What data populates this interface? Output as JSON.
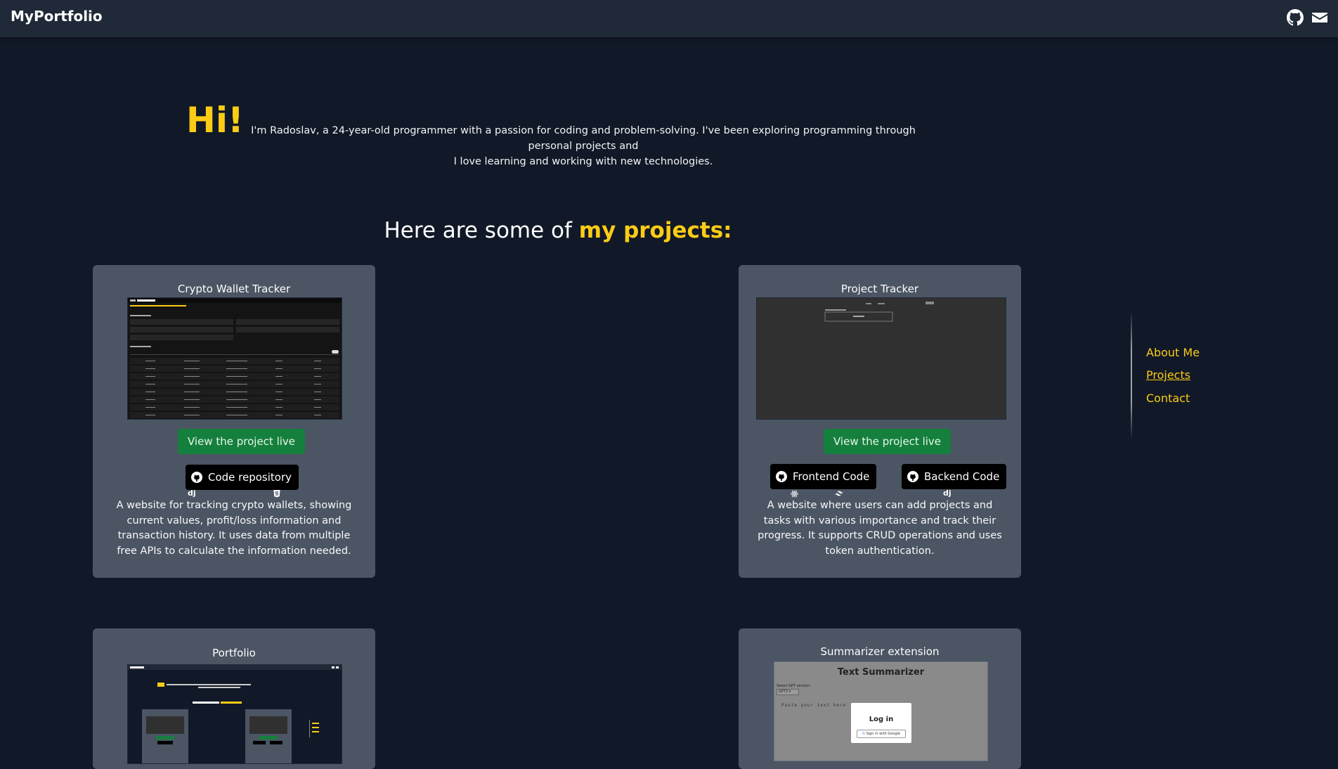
{
  "header": {
    "brand": "MyPortfolio",
    "icons": {
      "github": "github-icon",
      "mail": "mail-icon"
    }
  },
  "hero": {
    "greeting": "Hi!",
    "intro_line1": "I'm Radoslav, a 24-year-old programmer with a passion for coding and problem-solving. I've been exploring programming through personal projects and",
    "intro_line2": "I love learning and working with new technologies."
  },
  "projects_heading": {
    "prefix": "Here are some of ",
    "highlight": "my projects:"
  },
  "projects": [
    {
      "title": "Crypto Wallet Tracker",
      "live_label": "View the project live",
      "code_labels": [
        "Code repository"
      ],
      "tech_icons": [
        "django-icon",
        "html5-icon"
      ],
      "tech_text": [
        "dj"
      ],
      "description": "A website for tracking crypto wallets, showing current values, profit/loss information and transaction history. It uses data from multiple free APIs to calculate the information needed."
    },
    {
      "title": "Project Tracker",
      "live_label": "View the project live",
      "code_labels": [
        "Frontend Code",
        "Backend Code"
      ],
      "tech_icons": [
        "react-icon",
        "tailwind-icon",
        "django-icon"
      ],
      "tech_text": [
        "dj"
      ],
      "description": "A website where users can add projects and tasks with various importance and track their progress. It supports CRUD operations and uses token authentication."
    },
    {
      "title": "Portfolio"
    },
    {
      "title": "Summarizer extension",
      "preview": {
        "heading": "Text Summarizer",
        "select_label": "Select GPT version:",
        "select_value": "GPT3",
        "textarea_placeholder": "Paste your text here",
        "login_title": "Log in",
        "google_button": "Sign in with Google"
      }
    }
  ],
  "sidenav": {
    "items": [
      "About Me",
      "Projects",
      "Contact"
    ],
    "active": "Projects"
  },
  "colors": {
    "background": "#111827",
    "header": "#1f2937",
    "card": "#4b5563",
    "accent": "#facc15",
    "live_button": "#15803d"
  }
}
